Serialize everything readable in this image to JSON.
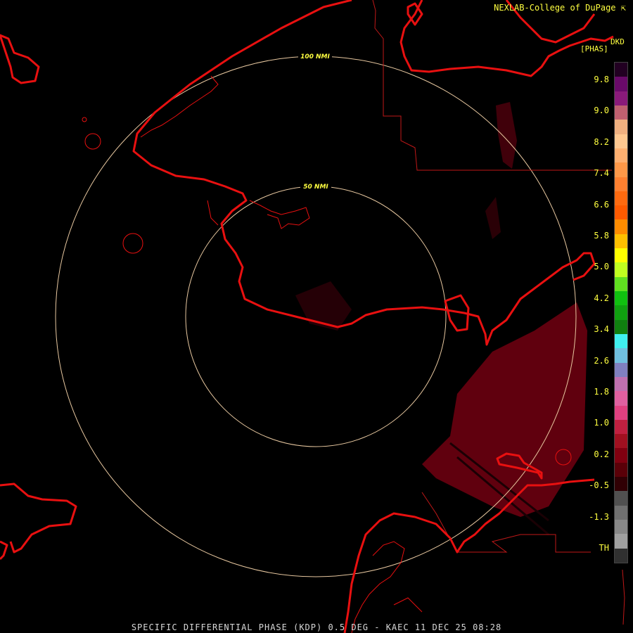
{
  "header": {
    "credit": "NEXLAB-College of DuPage",
    "credit_icon": "cursor-arrow-icon"
  },
  "units": {
    "product": "DKD",
    "unit": "[PHAS]"
  },
  "rings": [
    {
      "label": "100 NMI"
    },
    {
      "label": "50 NMI"
    }
  ],
  "scale": {
    "ticks": [
      "9.8",
      "9.0",
      "8.2",
      "7.4",
      "6.6",
      "5.8",
      "5.0",
      "4.2",
      "3.4",
      "2.6",
      "1.8",
      "1.0",
      "0.2",
      "-0.5",
      "-1.3",
      "TH"
    ],
    "colors": [
      "#220022",
      "#6a0a6a",
      "#8a1a7a",
      "#c06070",
      "#f0b080",
      "#ffc890",
      "#ffb070",
      "#ff9848",
      "#ff8030",
      "#ff6a10",
      "#ff5a00",
      "#ff8c00",
      "#ffc000",
      "#ffff00",
      "#c0ff20",
      "#60e020",
      "#10c010",
      "#10a010",
      "#108010",
      "#40f0f0",
      "#70c0e0",
      "#8080c0",
      "#c070b0",
      "#e060a0",
      "#e04080",
      "#c02040",
      "#a01020",
      "#800010",
      "#5a0008",
      "#300004",
      "#505050",
      "#707070",
      "#888888",
      "#a0a0a0",
      "#303030"
    ]
  },
  "footer": {
    "caption": "SPECIFIC DIFFERENTIAL PHASE (KDP) 0.5 DEG - KAEC 11 DEC 25 08:28"
  },
  "colors": {
    "coast": "#e81010",
    "border": "#c01818",
    "ring": "#e8c8a0",
    "echo": "#6a0010"
  }
}
